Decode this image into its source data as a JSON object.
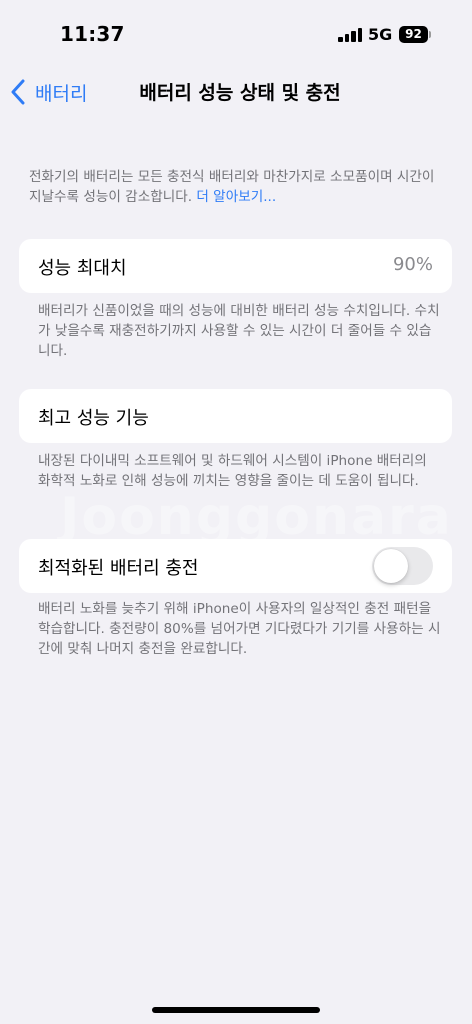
{
  "status_bar": {
    "time": "11:37",
    "network": "5G",
    "battery_level": "92"
  },
  "nav": {
    "back_label": "배터리",
    "title": "배터리 성능 상태 및 충전"
  },
  "intro": {
    "text": "전화기의 배터리는 모든 충전식 배터리와 마찬가지로 소모품이며 시간이 지날수록 성능이 감소합니다. ",
    "link": "더 알아보기..."
  },
  "max_capacity": {
    "label": "성능 최대치",
    "value": "90%",
    "footer": "배터리가 신품이었을 때의 성능에 대비한 배터리 성능 수치입니다. 수치가 낮을수록 재충전하기까지 사용할 수 있는 시간이 더 줄어들 수 있습니다."
  },
  "peak_performance": {
    "label": "최고 성능 기능",
    "footer": "내장된 다이내믹 소프트웨어 및 하드웨어 시스템이 iPhone 배터리의 화학적 노화로 인해 성능에 끼치는 영향을 줄이는 데 도움이 됩니다."
  },
  "optimized_charging": {
    "label": "최적화된 배터리 충전",
    "enabled": false,
    "footer": "배터리 노화를 늦추기 위해 iPhone이 사용자의 일상적인 충전 패턴을 학습합니다. 충전량이 80%를 넘어가면 기다렸다가 기기를 사용하는 시간에 맞춰 나머지 충전을 완료합니다."
  },
  "watermark": "Joonggonara",
  "colors": {
    "background": "#f2f1f6",
    "accent": "#2f7cf6",
    "secondary_text": "#737378",
    "toggle_off": "#e9e9eb"
  }
}
